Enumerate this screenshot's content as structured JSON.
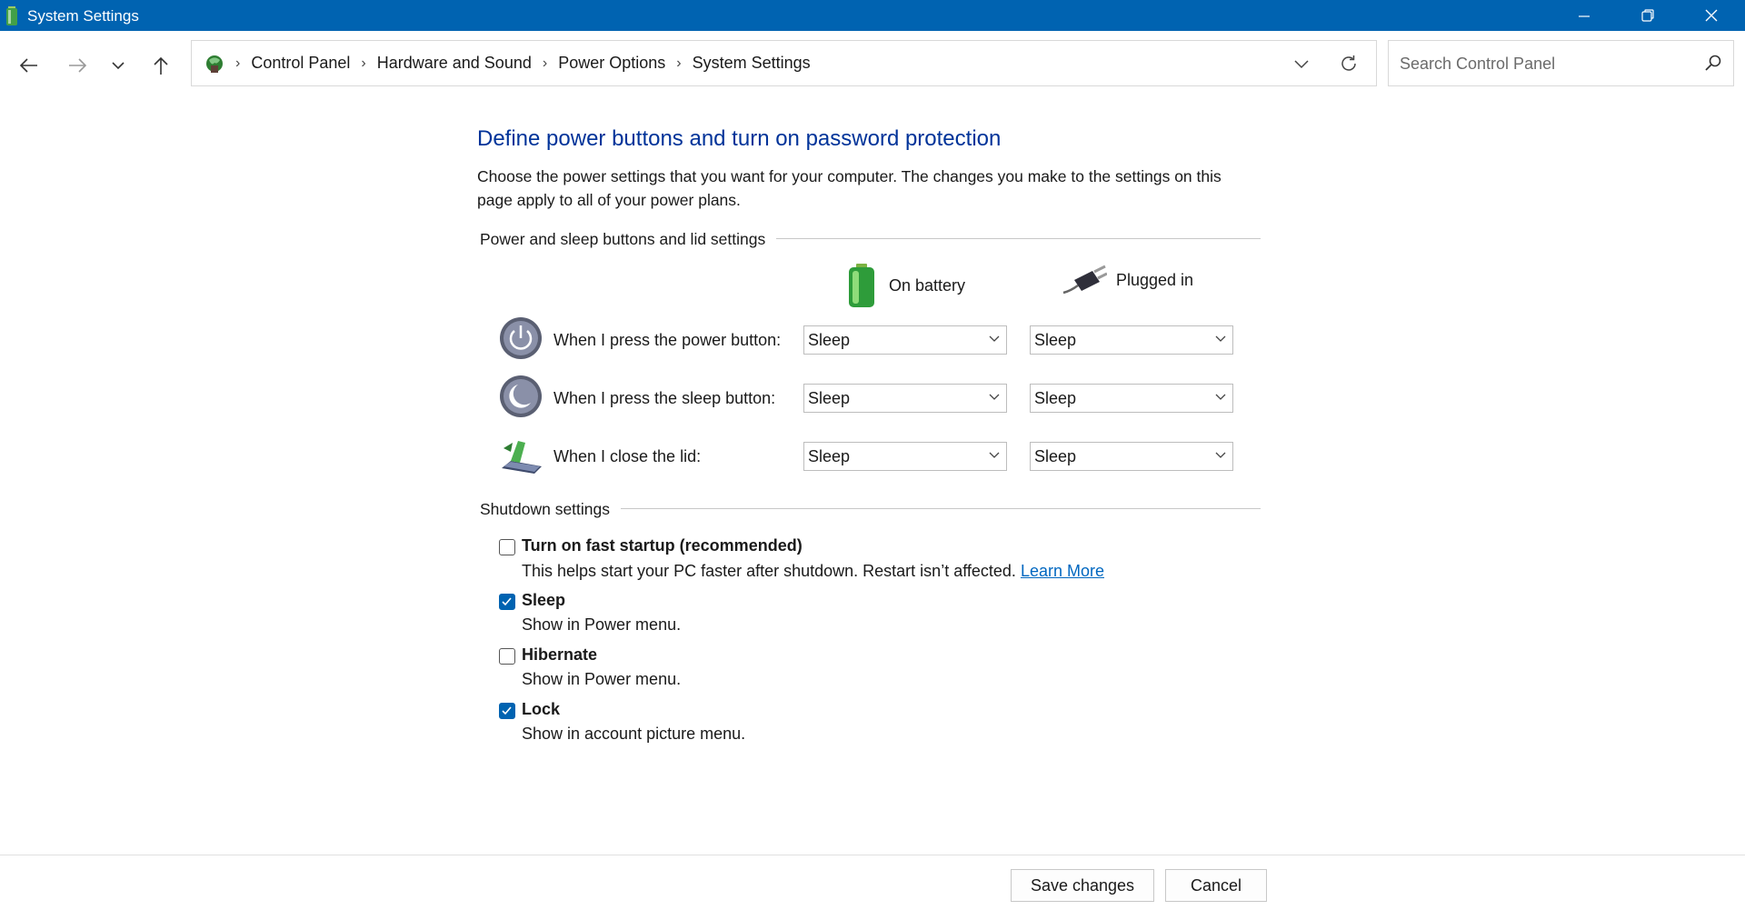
{
  "window": {
    "title": "System Settings",
    "accent_color": "#0063b1"
  },
  "nav": {
    "breadcrumb": [
      "Control Panel",
      "Hardware and Sound",
      "Power Options",
      "System Settings"
    ],
    "search_placeholder": "Search Control Panel"
  },
  "page": {
    "heading": "Define power buttons and turn on password protection",
    "description": "Choose the power settings that you want for your computer. The changes you make to the settings on this page apply to all of your power plans."
  },
  "power_section": {
    "title": "Power and sleep buttons and lid settings",
    "columns": [
      "On battery",
      "Plugged in"
    ],
    "rows": [
      {
        "label": "When I press the power button:",
        "icon": "power-button-icon",
        "on_battery": "Sleep",
        "plugged_in": "Sleep"
      },
      {
        "label": "When I press the sleep button:",
        "icon": "sleep-button-icon",
        "on_battery": "Sleep",
        "plugged_in": "Sleep"
      },
      {
        "label": "When I close the lid:",
        "icon": "laptop-lid-icon",
        "on_battery": "Sleep",
        "plugged_in": "Sleep"
      }
    ]
  },
  "shutdown_section": {
    "title": "Shutdown settings",
    "options": [
      {
        "label": "Turn on fast startup (recommended)",
        "description": "This helps start your PC faster after shutdown. Restart isn’t affected.",
        "link": "Learn More",
        "checked": false
      },
      {
        "label": "Sleep",
        "description": "Show in Power menu.",
        "checked": true
      },
      {
        "label": "Hibernate",
        "description": "Show in Power menu.",
        "checked": false
      },
      {
        "label": "Lock",
        "description": "Show in account picture menu.",
        "checked": true
      }
    ]
  },
  "footer": {
    "save_label": "Save changes",
    "cancel_label": "Cancel"
  }
}
